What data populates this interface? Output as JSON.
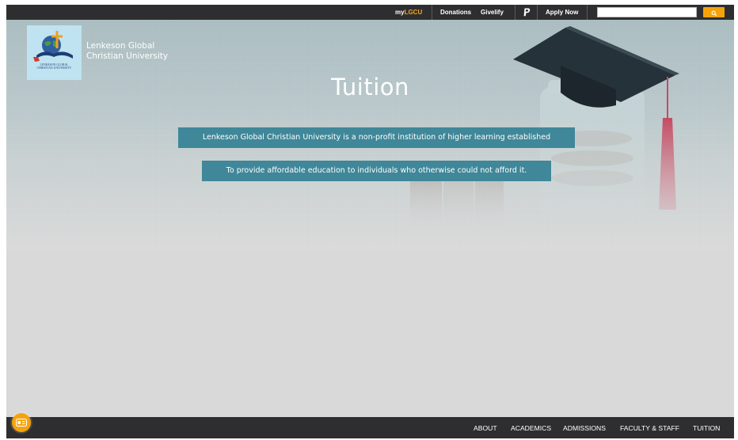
{
  "topbar": {
    "my_prefix": "my",
    "my_suffix": "LGCU",
    "donations": "Donations",
    "givelify": "Givelify",
    "paypal_icon": "paypal-icon",
    "apply_now": "Apply Now",
    "search_value": "",
    "search_icon": "search-icon"
  },
  "brand": {
    "logo_line1": "LENKESON GLOBAL",
    "logo_line2": "CHRISTIAN UNIVERSITY",
    "name_line1": "Lenkeson Global",
    "name_line2": "Christian University"
  },
  "hero": {
    "title": "Tuition",
    "tagline1": "Lenkeson Global Christian University is a non-profit institution of higher learning established",
    "tagline2": "To provide affordable education to individuals who otherwise could not afford it."
  },
  "nav": {
    "about": "ABOUT",
    "academics": "ACADEMICS",
    "admissions": "ADMISSIONS",
    "faculty_staff": "FACULTY & STAFF",
    "tuition": "TUITION"
  },
  "accessibility": {
    "icon": "accessibility-toggle-icon"
  },
  "colors": {
    "accent": "#f5a30c",
    "bar": "#2e2e30",
    "tagline_bg": "#3f8799",
    "page_bg": "#d9d9d9"
  }
}
